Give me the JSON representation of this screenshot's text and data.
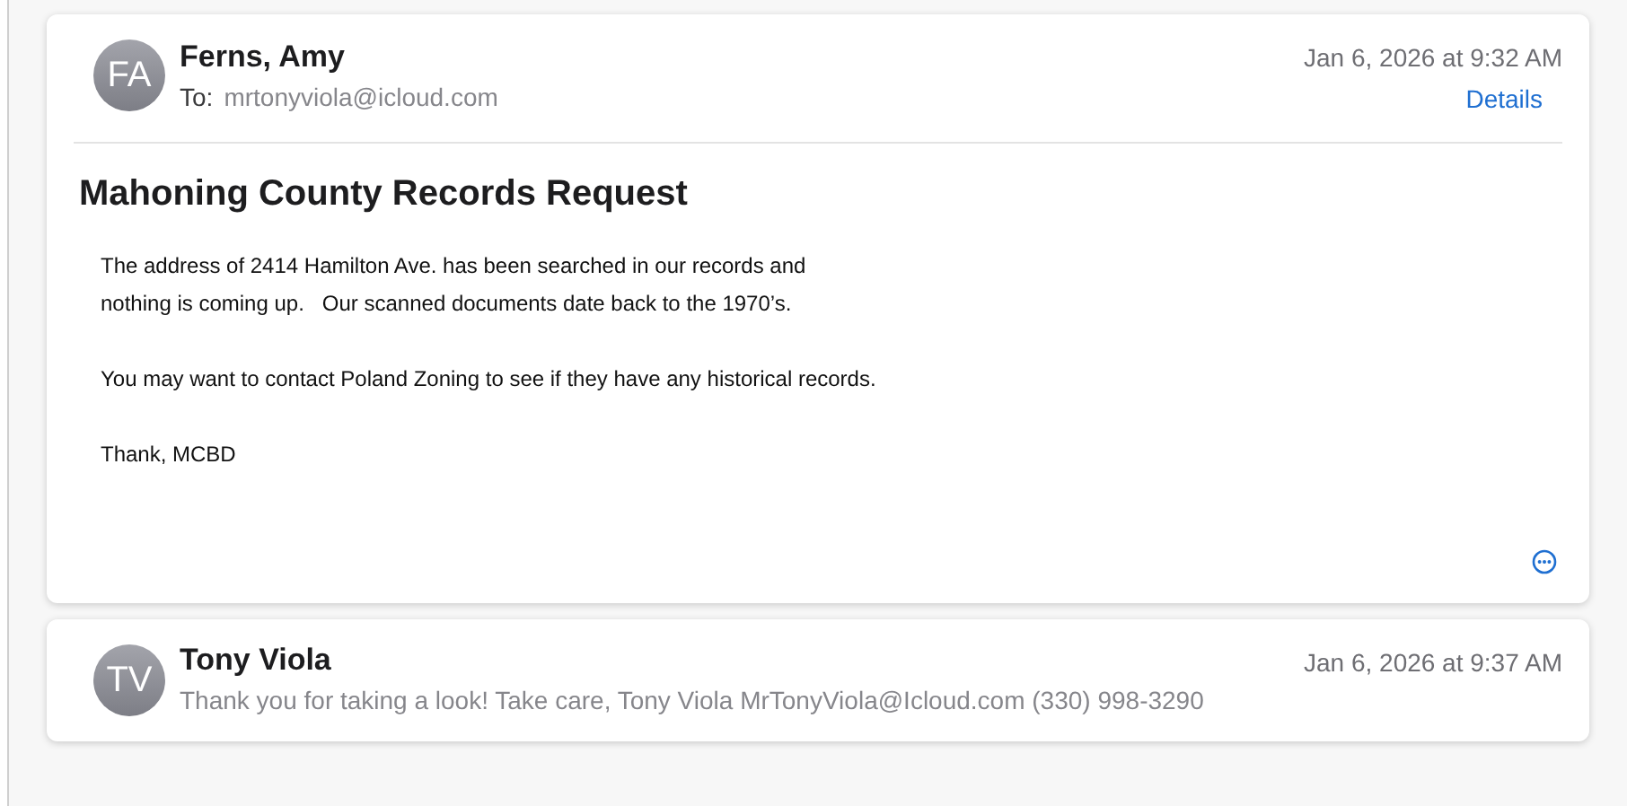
{
  "messages": [
    {
      "kind": "expanded",
      "initials": "FA",
      "sender": "Ferns, Amy",
      "to_label": "To:",
      "to": "mrtonyviola@icloud.com",
      "date": "Jan 6, 2026 at 9:32 AM",
      "details": "Details",
      "subject": "Mahoning County Records Request",
      "body": [
        [
          "The address of 2414 Hamilton Ave. has been searched in our records and",
          "nothing is coming up.   Our scanned documents date back to the 1970’s."
        ],
        [
          "You may want to contact Poland Zoning to see if they have any historical records."
        ],
        [
          "Thank, MCBD"
        ]
      ]
    },
    {
      "kind": "collapsed",
      "initials": "TV",
      "sender": "Tony Viola",
      "date": "Jan 6, 2026 at 9:37 AM",
      "preview": "Thank you for taking a look! Take care, Tony Viola MrTonyViola@Icloud.com (330) 998-3290"
    }
  ]
}
